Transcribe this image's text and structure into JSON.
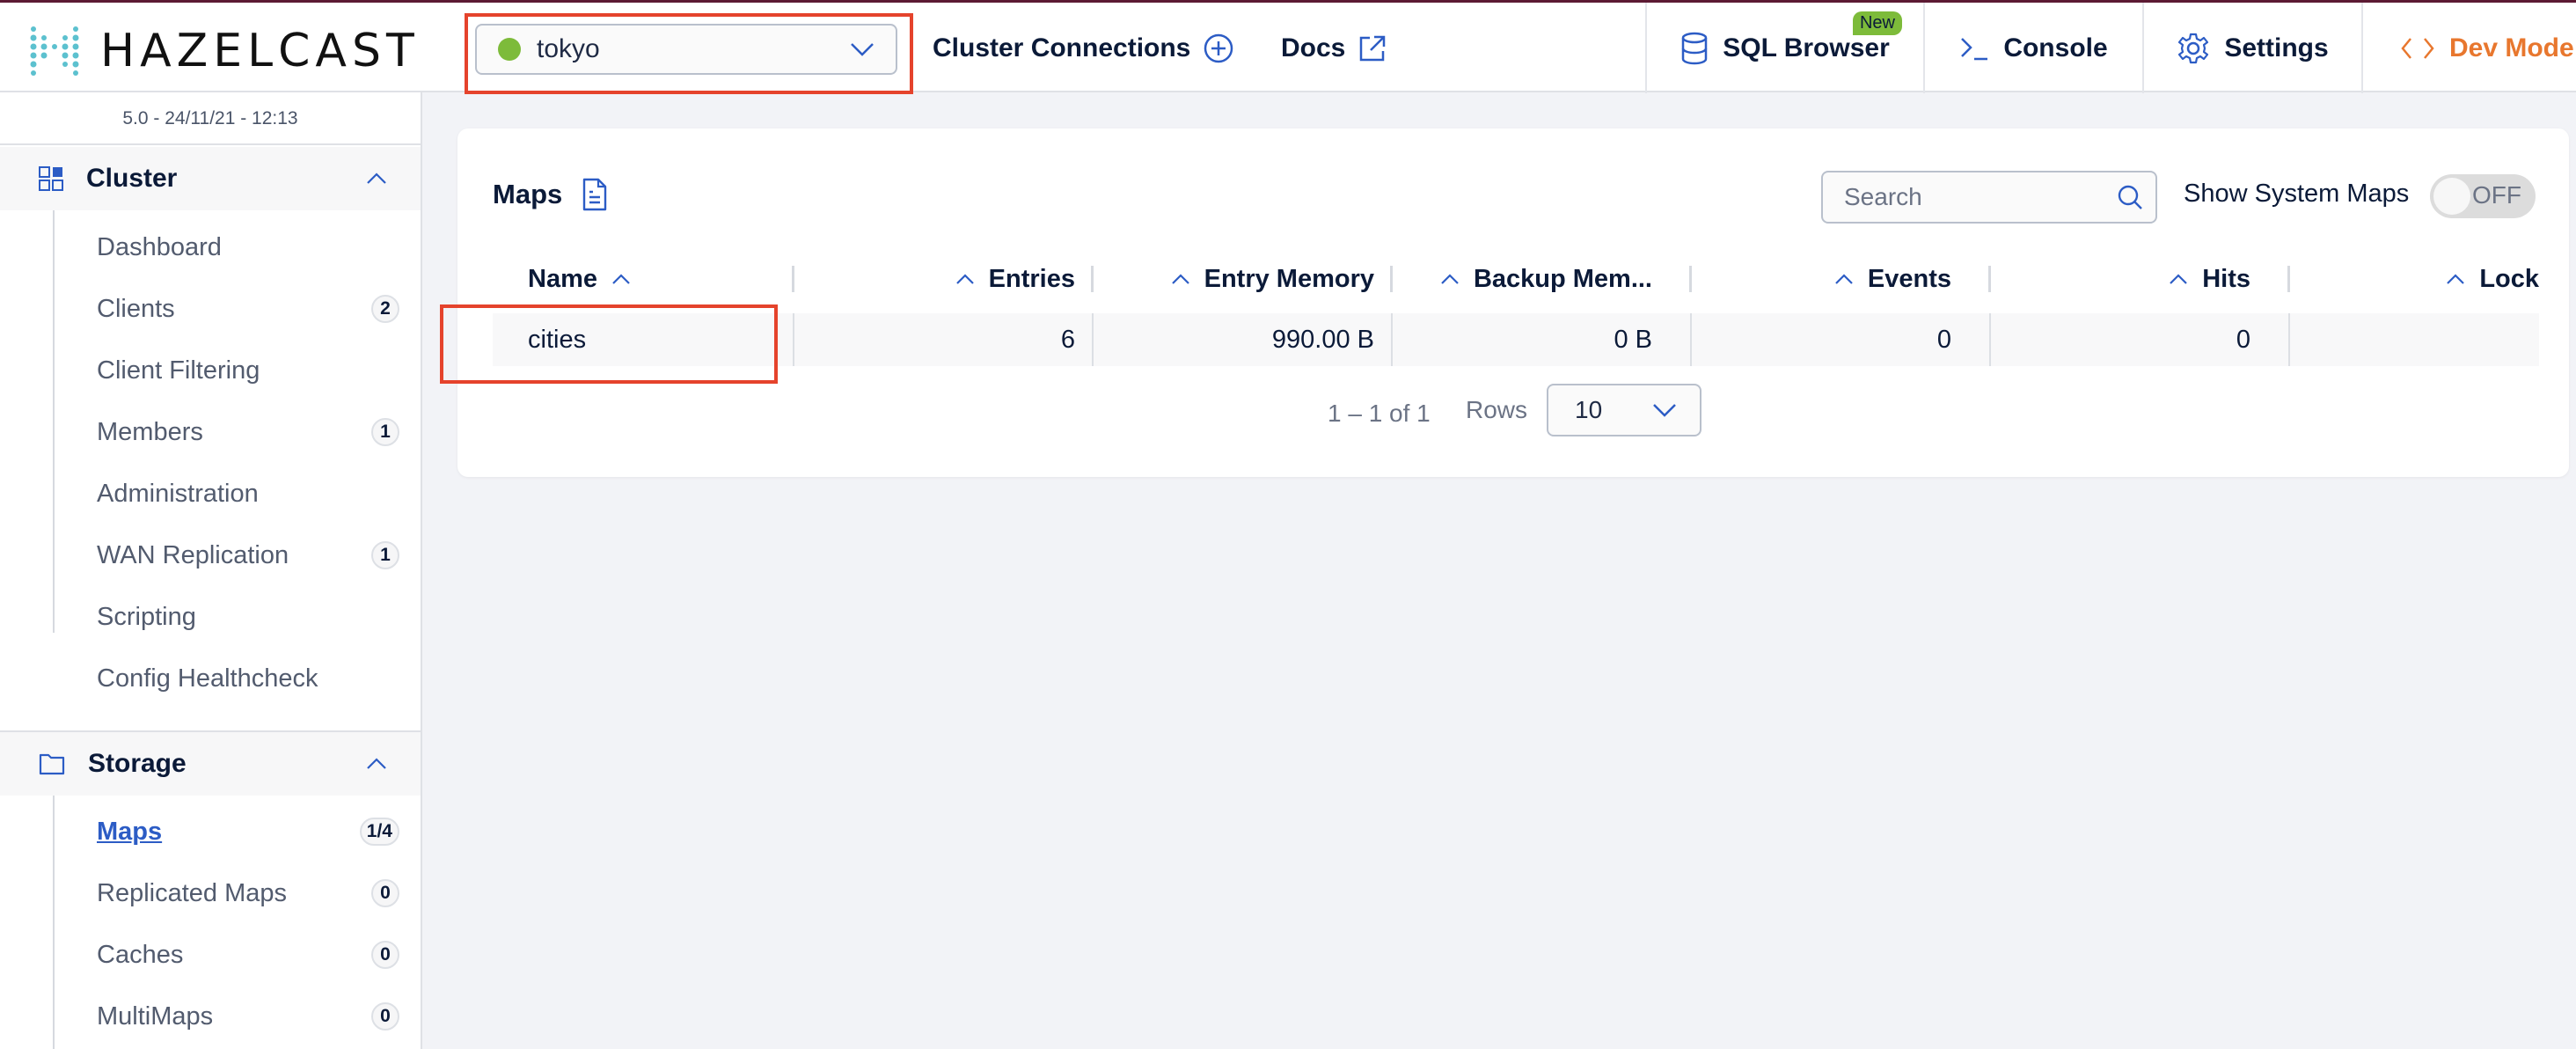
{
  "header": {
    "logo_text": "HAZELCAST",
    "cluster_select": {
      "value": "tokyo",
      "status_color": "#7dbb3a"
    },
    "links": [
      {
        "label": "Cluster Connections",
        "icon": "plus-circle-icon"
      },
      {
        "label": "Docs",
        "icon": "external-link-icon"
      }
    ],
    "right_nav": [
      {
        "label": "SQL Browser",
        "icon": "database-icon",
        "badge": "New"
      },
      {
        "label": "Console",
        "icon": "terminal-icon"
      },
      {
        "label": "Settings",
        "icon": "gear-icon"
      },
      {
        "label": "Dev Mode",
        "icon": "code-icon"
      }
    ],
    "colors": {
      "accent_blue": "#2c5cc5",
      "dev_mode": "#e8772e",
      "badge_green": "#7dbb3a",
      "top_border": "#5c1a33",
      "highlight_red": "#e5432c"
    }
  },
  "sidebar": {
    "version": "5.0 - 24/11/21 - 12:13",
    "sections": [
      {
        "title": "Cluster",
        "icon": "grid-icon",
        "items": [
          {
            "label": "Dashboard",
            "count": null
          },
          {
            "label": "Clients",
            "count": "2"
          },
          {
            "label": "Client Filtering",
            "count": null
          },
          {
            "label": "Members",
            "count": "1"
          },
          {
            "label": "Administration",
            "count": null
          },
          {
            "label": "WAN Replication",
            "count": "1"
          },
          {
            "label": "Scripting",
            "count": null
          },
          {
            "label": "Config Healthcheck",
            "count": null
          }
        ]
      },
      {
        "title": "Storage",
        "icon": "folder-icon",
        "items": [
          {
            "label": "Maps",
            "count": "1/4",
            "active": true
          },
          {
            "label": "Replicated Maps",
            "count": "0"
          },
          {
            "label": "Caches",
            "count": "0"
          },
          {
            "label": "MultiMaps",
            "count": "0"
          }
        ]
      }
    ]
  },
  "main": {
    "title": "Maps",
    "search": {
      "placeholder": "Search",
      "value": ""
    },
    "show_system_maps": {
      "label": "Show System Maps",
      "state": "OFF"
    },
    "table": {
      "columns": [
        "Name",
        "Entries",
        "Entry Memory",
        "Backup Mem...",
        "Events",
        "Hits",
        "Lock"
      ],
      "rows": [
        [
          "cities",
          "6",
          "990.00 B",
          "0 B",
          "0",
          "0",
          ""
        ]
      ]
    },
    "pagination": {
      "range": "1 – 1 of 1",
      "rows_label": "Rows",
      "rows_per_page": "10"
    }
  }
}
